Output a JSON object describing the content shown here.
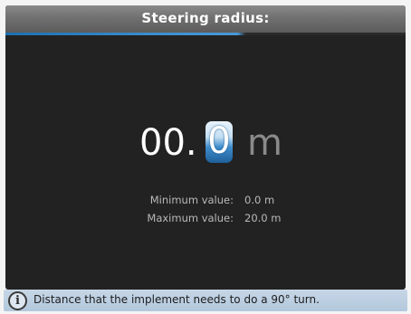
{
  "header": {
    "title": "Steering radius:"
  },
  "value_entry": {
    "fixed_digits": "00.",
    "active_digit": "0",
    "unit": "m"
  },
  "limits": {
    "minimum_label": "Minimum value:",
    "minimum_value": "0.0 m",
    "maximum_label": "Maximum value:",
    "maximum_value": "20.0 m"
  },
  "info_bar": {
    "icon": "info-icon",
    "text": "Distance that the implement needs to do a 90° turn."
  },
  "colors": {
    "accent": "#3d8fd0",
    "screen_background": "#222222",
    "info_background": "#b3c8dd"
  }
}
